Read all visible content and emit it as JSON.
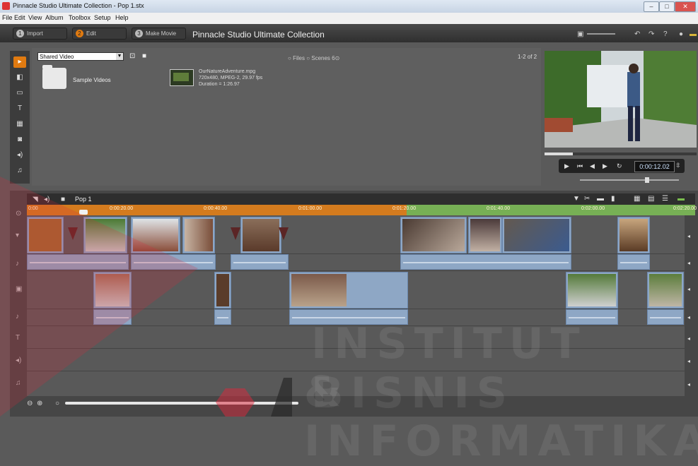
{
  "window": {
    "title": "Pinnacle Studio Ultimate Collection - Pop 1.stx"
  },
  "menu": [
    "File",
    "Edit",
    "View",
    "Album",
    "Toolbox",
    "Setup",
    "Help"
  ],
  "toolbar": {
    "import_num": "1",
    "import_label": "Import",
    "edit_num": "2",
    "edit_label": "Edit",
    "make_num": "3",
    "make_label": "Make Movie",
    "app_title": "Pinnacle Studio Ultimate Collection"
  },
  "library": {
    "location": "Shared Video",
    "folder_label": "Sample Videos",
    "file": {
      "name": "OurNatureAdventure.mpg",
      "format": "720x480, MPEG-2, 29.97 fps",
      "duration": "Duration = 1:26.97"
    },
    "view_files": "Files",
    "view_scenes": "Scenes",
    "pager": "1-2 of 2"
  },
  "player": {
    "timecode": "0:00:12.02"
  },
  "timeline": {
    "project": "Pop 1",
    "ticks": [
      "0:00",
      "0:00:20.00",
      "0:00:40.00",
      "0:01:00.00",
      "0:01:20.00",
      "0:01:40.00",
      "0:02:00.00",
      "0:02:20.00"
    ]
  },
  "watermark": {
    "line1": "INSTITUT BISNIS",
    "line2": "& INFORMATIKA"
  },
  "colors": {
    "accent": "#e07a10",
    "ruler": "#d47b1e",
    "ruler_green": "#77b055",
    "clip": "#8ea7c5"
  }
}
